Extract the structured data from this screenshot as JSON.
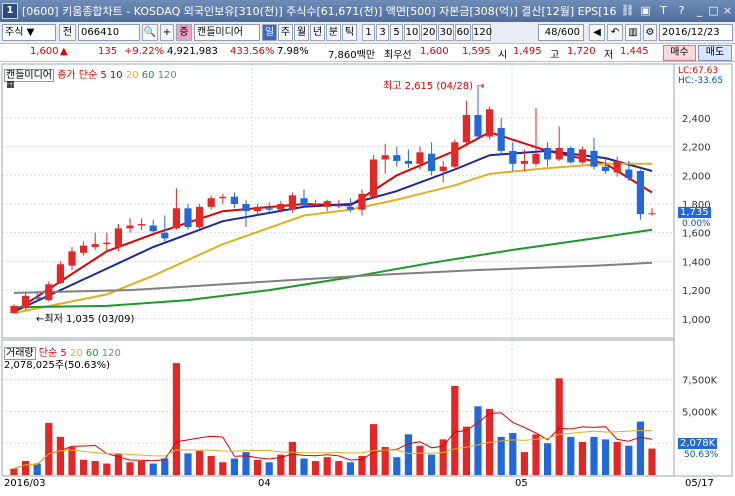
{
  "window": {
    "num": "1",
    "title": "[0600] 키움종합차트 - KOSDAQ 외국인보유[310(천)] 주식수[61,671(천)] 액면[500] 자본금[308(억)] 결산[12월] EPS[16"
  },
  "toolbar": {
    "market": "주식",
    "all_btn": "전",
    "code": "066410",
    "chart_type_btn": "증",
    "chart_type": "캔들미디어",
    "periods": [
      "일",
      "주",
      "월",
      "년",
      "분",
      "틱"
    ],
    "minutes": [
      "1",
      "3",
      "5",
      "10",
      "20",
      "30",
      "60",
      "120"
    ],
    "count": "48",
    "count_max": "/600",
    "date": "2016/12/23"
  },
  "quote": {
    "price": "1,600",
    "change": "135",
    "change_pct": "+9.22%",
    "volume": "4,921,983",
    "vol_ratio": "433.56%",
    "turnover": "7.98%",
    "amount": "7,860백만",
    "tag": "최우선",
    "ask": "1,600",
    "bid": "1,595",
    "open_label": "시",
    "open": "1,495",
    "high_label": "고",
    "high": "1,720",
    "low_label": "저",
    "low": "1,445",
    "buy_btn": "매수",
    "sell_btn": "매도"
  },
  "price_pane": {
    "legend_name": "캔들미디어",
    "legend_ma": "종가 단순",
    "ma_periods": [
      "5",
      "10",
      "20",
      "60",
      "120"
    ],
    "lc": "LC:67.63",
    "hc": "HC:-33.65",
    "max_label": "최고 2,615 (04/28) →",
    "min_label": "←최저 1,035 (03/09)",
    "last_price": "1,735",
    "last_pct": "0.00%"
  },
  "volume_pane": {
    "legend_name": "거래량",
    "legend_ma": "단순",
    "ma_periods": [
      "5",
      "20",
      "60",
      "120"
    ],
    "current": "2,078,025주(50.63%)",
    "last_vol": "2,078K",
    "last_pct": "50.63%"
  },
  "x_labels": [
    "2016/03",
    "04",
    "05",
    "05/17"
  ],
  "colors": {
    "up": "#e32626",
    "down": "#2268d8",
    "ma5": "#e00000",
    "ma10": "#1a2a9c",
    "ma20": "#e0b020",
    "ma60": "#1a9a2a",
    "ma120": "#808080"
  },
  "chart_data": {
    "type": "candlestick",
    "y_axis_price": [
      1000,
      1200,
      1400,
      1600,
      1800,
      2000,
      2200,
      2400
    ],
    "y_axis_volume": [
      "2,500K",
      "5,000K",
      "7,500K"
    ],
    "candles": [
      {
        "o": 1040,
        "h": 1100,
        "l": 1035,
        "c": 1090,
        "v": 500
      },
      {
        "o": 1080,
        "h": 1180,
        "l": 1060,
        "c": 1160,
        "v": 1100
      },
      {
        "o": 1150,
        "h": 1190,
        "l": 1120,
        "c": 1140,
        "v": 900
      },
      {
        "o": 1130,
        "h": 1260,
        "l": 1120,
        "c": 1240,
        "v": 4100
      },
      {
        "o": 1250,
        "h": 1400,
        "l": 1240,
        "c": 1380,
        "v": 3000
      },
      {
        "o": 1370,
        "h": 1500,
        "l": 1340,
        "c": 1470,
        "v": 2200
      },
      {
        "o": 1460,
        "h": 1540,
        "l": 1440,
        "c": 1510,
        "v": 1200
      },
      {
        "o": 1500,
        "h": 1600,
        "l": 1480,
        "c": 1520,
        "v": 1100
      },
      {
        "o": 1520,
        "h": 1600,
        "l": 1470,
        "c": 1530,
        "v": 900
      },
      {
        "o": 1500,
        "h": 1660,
        "l": 1470,
        "c": 1630,
        "v": 1700
      },
      {
        "o": 1630,
        "h": 1700,
        "l": 1600,
        "c": 1650,
        "v": 1000
      },
      {
        "o": 1650,
        "h": 1700,
        "l": 1620,
        "c": 1660,
        "v": 1100
      },
      {
        "o": 1650,
        "h": 1690,
        "l": 1600,
        "c": 1610,
        "v": 900
      },
      {
        "o": 1600,
        "h": 1720,
        "l": 1540,
        "c": 1560,
        "v": 1300
      },
      {
        "o": 1630,
        "h": 1910,
        "l": 1620,
        "c": 1770,
        "v": 8800
      },
      {
        "o": 1770,
        "h": 1800,
        "l": 1620,
        "c": 1640,
        "v": 1700
      },
      {
        "o": 1640,
        "h": 1800,
        "l": 1620,
        "c": 1780,
        "v": 1900
      },
      {
        "o": 1780,
        "h": 1860,
        "l": 1760,
        "c": 1840,
        "v": 1500
      },
      {
        "o": 1840,
        "h": 1870,
        "l": 1800,
        "c": 1850,
        "v": 1000
      },
      {
        "o": 1850,
        "h": 1880,
        "l": 1770,
        "c": 1800,
        "v": 1300
      },
      {
        "o": 1800,
        "h": 1830,
        "l": 1640,
        "c": 1750,
        "v": 1800
      },
      {
        "o": 1750,
        "h": 1800,
        "l": 1720,
        "c": 1780,
        "v": 1200
      },
      {
        "o": 1770,
        "h": 1810,
        "l": 1740,
        "c": 1760,
        "v": 1000
      },
      {
        "o": 1760,
        "h": 1820,
        "l": 1740,
        "c": 1800,
        "v": 1600
      },
      {
        "o": 1760,
        "h": 1880,
        "l": 1740,
        "c": 1860,
        "v": 2600
      },
      {
        "o": 1840,
        "h": 1900,
        "l": 1780,
        "c": 1790,
        "v": 1300
      },
      {
        "o": 1790,
        "h": 1830,
        "l": 1780,
        "c": 1800,
        "v": 1100
      },
      {
        "o": 1780,
        "h": 1830,
        "l": 1750,
        "c": 1820,
        "v": 1400
      },
      {
        "o": 1790,
        "h": 1830,
        "l": 1770,
        "c": 1790,
        "v": 1100
      },
      {
        "o": 1780,
        "h": 1840,
        "l": 1740,
        "c": 1760,
        "v": 1000
      },
      {
        "o": 1760,
        "h": 1900,
        "l": 1720,
        "c": 1870,
        "v": 1500
      },
      {
        "o": 1850,
        "h": 2140,
        "l": 1840,
        "c": 2110,
        "v": 4000
      },
      {
        "o": 2110,
        "h": 2220,
        "l": 2010,
        "c": 2140,
        "v": 2200
      },
      {
        "o": 2140,
        "h": 2200,
        "l": 2060,
        "c": 2100,
        "v": 1400
      },
      {
        "o": 2100,
        "h": 2180,
        "l": 2050,
        "c": 2080,
        "v": 3200
      },
      {
        "o": 2080,
        "h": 2200,
        "l": 2040,
        "c": 2160,
        "v": 2300
      },
      {
        "o": 2150,
        "h": 2230,
        "l": 2000,
        "c": 2030,
        "v": 1600
      },
      {
        "o": 2030,
        "h": 2100,
        "l": 1950,
        "c": 2060,
        "v": 2800
      },
      {
        "o": 2060,
        "h": 2250,
        "l": 2040,
        "c": 2230,
        "v": 7000
      },
      {
        "o": 2230,
        "h": 2520,
        "l": 2200,
        "c": 2420,
        "v": 3800
      },
      {
        "o": 2420,
        "h": 2615,
        "l": 2260,
        "c": 2270,
        "v": 5400
      },
      {
        "o": 2270,
        "h": 2480,
        "l": 2250,
        "c": 2460,
        "v": 5200
      },
      {
        "o": 2330,
        "h": 2400,
        "l": 2140,
        "c": 2170,
        "v": 3000
      },
      {
        "o": 2170,
        "h": 2230,
        "l": 2030,
        "c": 2080,
        "v": 3300
      },
      {
        "o": 2080,
        "h": 2180,
        "l": 2030,
        "c": 2100,
        "v": 1800
      },
      {
        "o": 2080,
        "h": 2470,
        "l": 2060,
        "c": 2150,
        "v": 3200
      },
      {
        "o": 2190,
        "h": 2230,
        "l": 2060,
        "c": 2110,
        "v": 2500
      },
      {
        "o": 2110,
        "h": 2340,
        "l": 2100,
        "c": 2190,
        "v": 7600
      },
      {
        "o": 2190,
        "h": 2200,
        "l": 2080,
        "c": 2090,
        "v": 3000
      },
      {
        "o": 2090,
        "h": 2200,
        "l": 2080,
        "c": 2180,
        "v": 2600
      },
      {
        "o": 2170,
        "h": 2260,
        "l": 2040,
        "c": 2060,
        "v": 3000
      },
      {
        "o": 2060,
        "h": 2120,
        "l": 2010,
        "c": 2030,
        "v": 2800
      },
      {
        "o": 2020,
        "h": 2130,
        "l": 1990,
        "c": 2100,
        "v": 2600
      },
      {
        "o": 2040,
        "h": 2100,
        "l": 1960,
        "c": 1980,
        "v": 2300
      },
      {
        "o": 2030,
        "h": 2040,
        "l": 1690,
        "c": 1730,
        "v": 4200
      },
      {
        "o": 1730,
        "h": 1770,
        "l": 1720,
        "c": 1735,
        "v": 2078
      }
    ],
    "ma_series": [
      {
        "name": "5",
        "values": [
          [
            0,
            1050
          ],
          [
            8,
            1470
          ],
          [
            12,
            1590
          ],
          [
            18,
            1750
          ],
          [
            25,
            1800
          ],
          [
            29,
            1790
          ],
          [
            33,
            2000
          ],
          [
            38,
            2170
          ],
          [
            41,
            2300
          ],
          [
            46,
            2170
          ],
          [
            51,
            2080
          ],
          [
            55,
            1880
          ]
        ]
      },
      {
        "name": "10",
        "values": [
          [
            0,
            1050
          ],
          [
            8,
            1350
          ],
          [
            12,
            1500
          ],
          [
            18,
            1680
          ],
          [
            25,
            1780
          ],
          [
            29,
            1800
          ],
          [
            33,
            1890
          ],
          [
            38,
            2040
          ],
          [
            41,
            2140
          ],
          [
            46,
            2170
          ],
          [
            51,
            2120
          ],
          [
            55,
            2030
          ]
        ]
      },
      {
        "name": "20",
        "values": [
          [
            0,
            1040
          ],
          [
            8,
            1170
          ],
          [
            12,
            1300
          ],
          [
            18,
            1520
          ],
          [
            25,
            1720
          ],
          [
            29,
            1760
          ],
          [
            33,
            1830
          ],
          [
            38,
            1930
          ],
          [
            41,
            2010
          ],
          [
            46,
            2050
          ],
          [
            51,
            2080
          ],
          [
            55,
            2080
          ]
        ]
      },
      {
        "name": "60",
        "values": [
          [
            0,
            1080
          ],
          [
            8,
            1090
          ],
          [
            15,
            1130
          ],
          [
            22,
            1200
          ],
          [
            29,
            1290
          ],
          [
            36,
            1390
          ],
          [
            43,
            1480
          ],
          [
            50,
            1560
          ],
          [
            55,
            1620
          ]
        ]
      },
      {
        "name": "120",
        "values": [
          [
            0,
            1180
          ],
          [
            10,
            1200
          ],
          [
            20,
            1250
          ],
          [
            30,
            1300
          ],
          [
            40,
            1340
          ],
          [
            50,
            1370
          ],
          [
            55,
            1390
          ]
        ]
      }
    ]
  }
}
